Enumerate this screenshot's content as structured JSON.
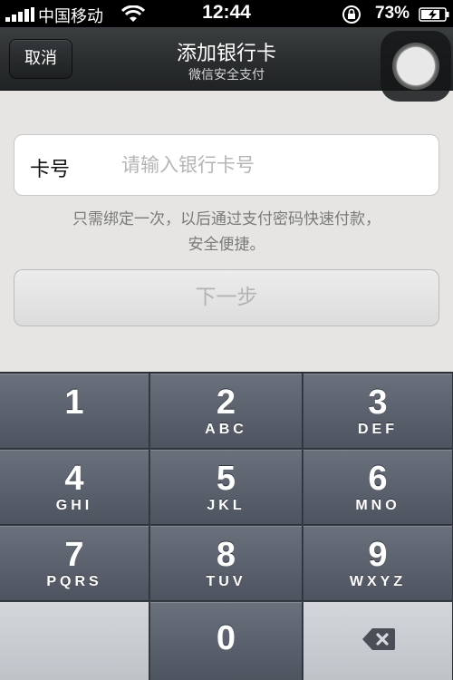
{
  "status_bar": {
    "carrier": "中国移动",
    "time": "12:44",
    "battery": "73%"
  },
  "nav": {
    "cancel_label": "取消",
    "title": "添加银行卡",
    "subtitle": "微信安全支付"
  },
  "form": {
    "card_label": "卡号",
    "card_placeholder": "请输入银行卡号",
    "card_value": "",
    "hint_line1": "只需绑定一次，以后通过支付密码快速付款，",
    "hint_line2": "安全便捷。",
    "next_label": "下一步"
  },
  "keypad": {
    "keys": [
      {
        "digit": "1",
        "letters": ""
      },
      {
        "digit": "2",
        "letters": "ABC"
      },
      {
        "digit": "3",
        "letters": "DEF"
      },
      {
        "digit": "4",
        "letters": "GHI"
      },
      {
        "digit": "5",
        "letters": "JKL"
      },
      {
        "digit": "6",
        "letters": "MNO"
      },
      {
        "digit": "7",
        "letters": "PQRS"
      },
      {
        "digit": "8",
        "letters": "TUV"
      },
      {
        "digit": "9",
        "letters": "WXYZ"
      },
      {
        "digit": "0",
        "letters": ""
      }
    ],
    "delete_icon": "backspace-icon"
  },
  "colors": {
    "nav_bar": "#2a2d2e",
    "page_bg": "#e6e5e3",
    "key_dark": "#5a606b",
    "key_light": "#c9ccd0"
  }
}
